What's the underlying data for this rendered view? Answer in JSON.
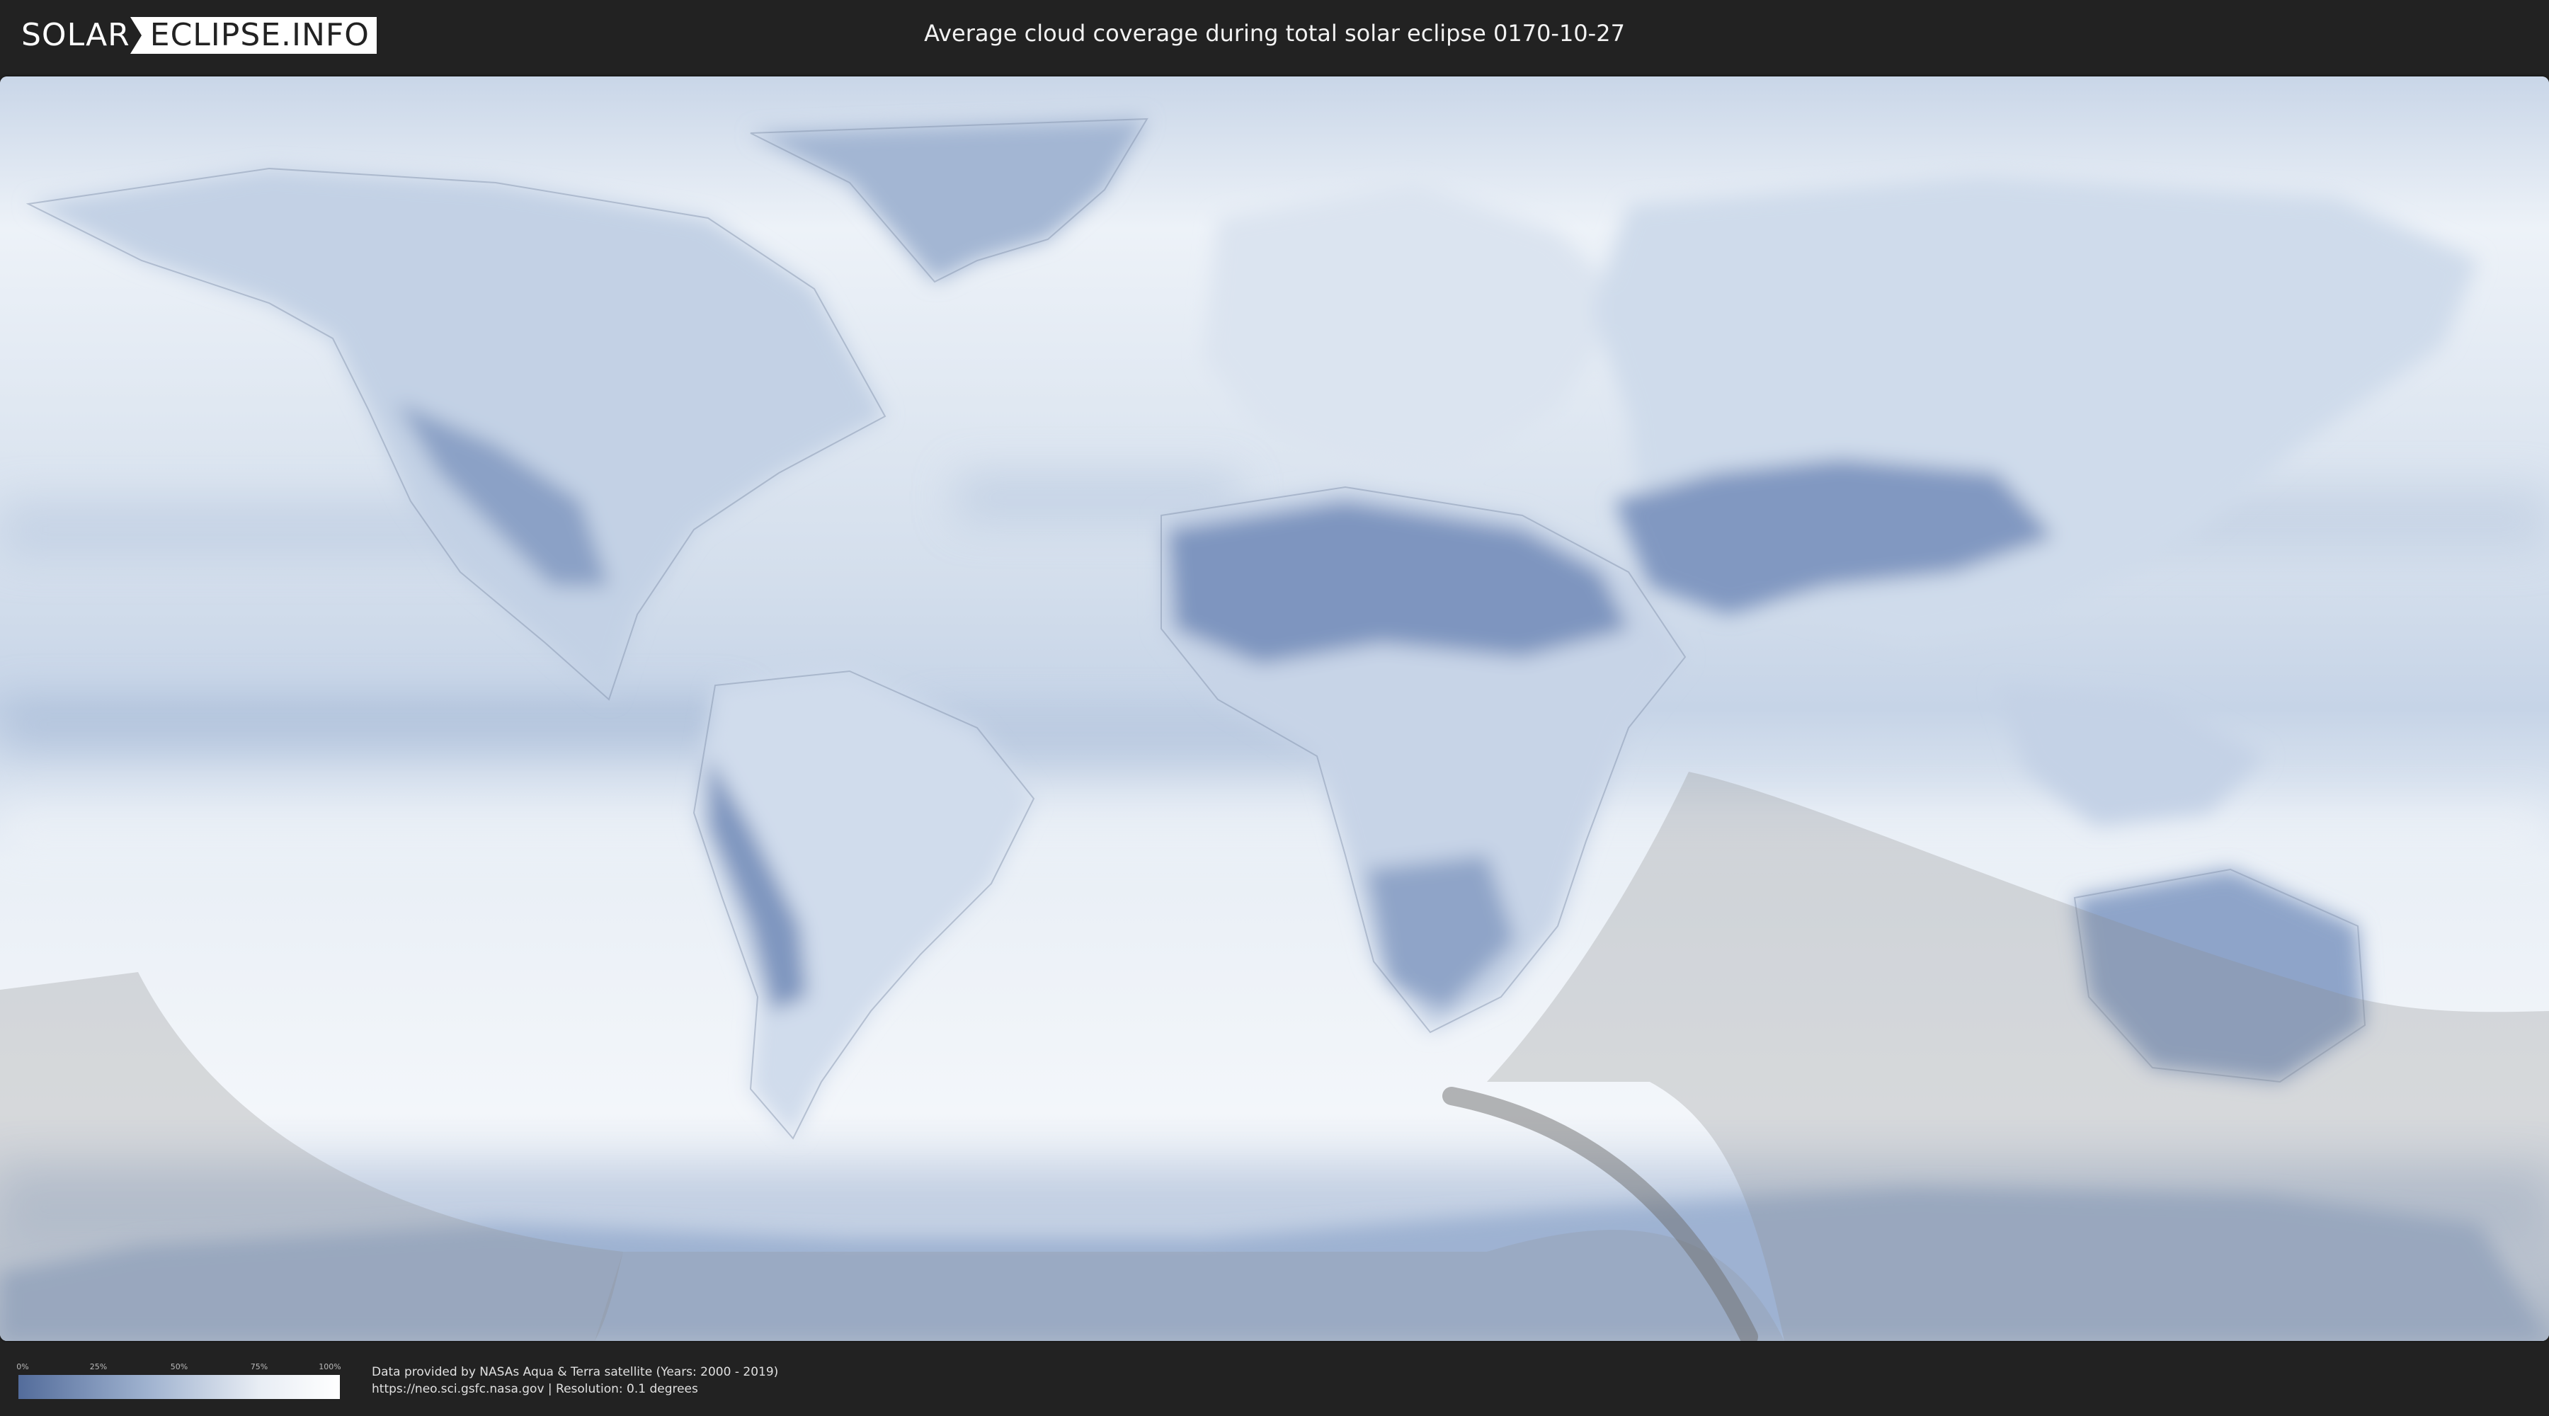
{
  "header": {
    "logo_left": "SOLAR",
    "logo_right": "ECLIPSE.INFO",
    "title": "Average cloud coverage during total solar eclipse 0170-10-27"
  },
  "legend": {
    "ticks": [
      "0%",
      "25%",
      "50%",
      "75%",
      "100%"
    ],
    "tick_values": [
      0,
      25,
      50,
      75,
      100
    ],
    "colors": {
      "min": "#536c9b",
      "max": "#ffffff"
    }
  },
  "footer": {
    "source_line": "Data provided by NASAs Aqua & Terra satellite (Years: 2000 - 2019)",
    "url_line": "https://neo.sci.gsfc.nasa.gov | Resolution: 0.1 degrees"
  },
  "colors": {
    "background": "#222222",
    "ocean_clouds": "#e6edf5",
    "clear_sky": "#5a77a8",
    "night_shade": "#8a8a8a"
  }
}
